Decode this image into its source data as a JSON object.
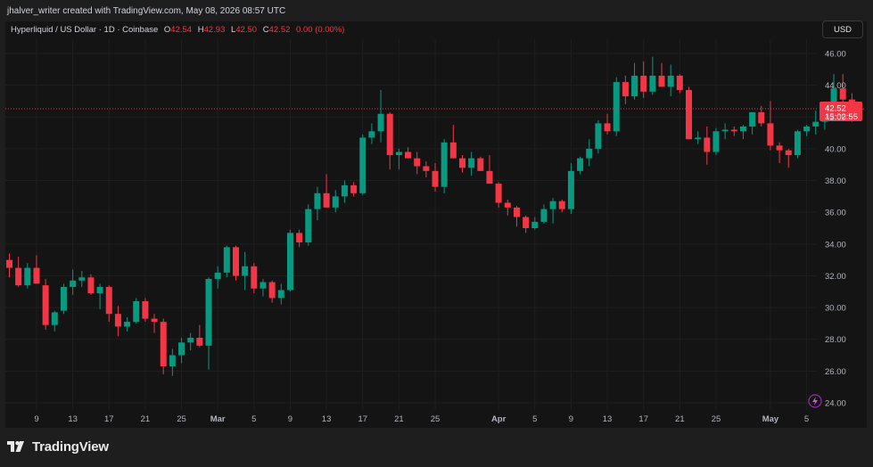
{
  "header": {
    "credit": "jhalver_writer created with TradingView.com, May 08, 2026 08:57 UTC",
    "currency": "USD"
  },
  "legend": {
    "title": "Hyperliquid / US Dollar · 1D · Coinbase",
    "o_label": "O",
    "o": "42.54",
    "h_label": "H",
    "h": "42.93",
    "l_label": "L",
    "l": "42.50",
    "c_label": "C",
    "c": "42.52",
    "change": "0.00 (0.00%)"
  },
  "price_tag": {
    "price": "42.52",
    "countdown": "15:02:55"
  },
  "brand": {
    "name": "TradingView"
  },
  "colors": {
    "up": "#089981",
    "down": "#f23645",
    "background": "#141414",
    "grid": "#1f1f1f",
    "axis_text": "#b2b5be"
  },
  "chart_data": {
    "type": "candlestick",
    "title": "Hyperliquid / US Dollar · 1D · Coinbase",
    "ylim": [
      24,
      46.5
    ],
    "y_ticks": [
      "24.00",
      "26.00",
      "28.00",
      "30.00",
      "32.00",
      "34.00",
      "36.00",
      "38.00",
      "40.00",
      "42.00",
      "44.00",
      "46.00"
    ],
    "y_tick_values": [
      24,
      26,
      28,
      30,
      32,
      34,
      36,
      38,
      40,
      42,
      44,
      46
    ],
    "x_ticks": [
      {
        "day": 3,
        "label": "9"
      },
      {
        "day": 7,
        "label": "13"
      },
      {
        "day": 11,
        "label": "17"
      },
      {
        "day": 15,
        "label": "21"
      },
      {
        "day": 19,
        "label": "25"
      },
      {
        "day": 23,
        "label": "Mar"
      },
      {
        "day": 27,
        "label": "5"
      },
      {
        "day": 31,
        "label": "9"
      },
      {
        "day": 35,
        "label": "13"
      },
      {
        "day": 39,
        "label": "17"
      },
      {
        "day": 43,
        "label": "21"
      },
      {
        "day": 47,
        "label": "25"
      },
      {
        "day": 54,
        "label": "Apr"
      },
      {
        "day": 58,
        "label": "5"
      },
      {
        "day": 62,
        "label": "9"
      },
      {
        "day": 66,
        "label": "13"
      },
      {
        "day": 70,
        "label": "17"
      },
      {
        "day": 74,
        "label": "21"
      },
      {
        "day": 78,
        "label": "25"
      },
      {
        "day": 84,
        "label": "May"
      },
      {
        "day": 88,
        "label": "5"
      }
    ],
    "first_date": "Feb 6",
    "last_date": "May 8",
    "candles": [
      {
        "o": 33.0,
        "h": 33.4,
        "l": 31.9,
        "c": 32.5
      },
      {
        "o": 32.5,
        "h": 33.2,
        "l": 31.3,
        "c": 31.4
      },
      {
        "o": 31.4,
        "h": 32.8,
        "l": 31.2,
        "c": 32.5
      },
      {
        "o": 32.5,
        "h": 33.3,
        "l": 31.6,
        "c": 31.5
      },
      {
        "o": 31.4,
        "h": 31.8,
        "l": 28.6,
        "c": 28.9
      },
      {
        "o": 28.9,
        "h": 29.8,
        "l": 28.5,
        "c": 29.7
      },
      {
        "o": 29.8,
        "h": 31.5,
        "l": 29.6,
        "c": 31.3
      },
      {
        "o": 31.3,
        "h": 32.4,
        "l": 30.8,
        "c": 31.7
      },
      {
        "o": 31.7,
        "h": 32.3,
        "l": 31.3,
        "c": 31.9
      },
      {
        "o": 31.9,
        "h": 32.1,
        "l": 30.8,
        "c": 30.9
      },
      {
        "o": 30.9,
        "h": 31.5,
        "l": 29.9,
        "c": 31.3
      },
      {
        "o": 31.3,
        "h": 31.4,
        "l": 29.1,
        "c": 29.6
      },
      {
        "o": 29.6,
        "h": 30.1,
        "l": 28.2,
        "c": 28.8
      },
      {
        "o": 28.8,
        "h": 29.4,
        "l": 28.5,
        "c": 29.1
      },
      {
        "o": 29.1,
        "h": 30.6,
        "l": 29.0,
        "c": 30.4
      },
      {
        "o": 30.4,
        "h": 30.6,
        "l": 29.1,
        "c": 29.3
      },
      {
        "o": 29.3,
        "h": 29.6,
        "l": 28.4,
        "c": 29.1
      },
      {
        "o": 29.1,
        "h": 29.3,
        "l": 25.8,
        "c": 26.3
      },
      {
        "o": 26.3,
        "h": 27.4,
        "l": 25.7,
        "c": 27.0
      },
      {
        "o": 27.0,
        "h": 28.1,
        "l": 26.5,
        "c": 27.8
      },
      {
        "o": 27.8,
        "h": 28.4,
        "l": 27.3,
        "c": 28.1
      },
      {
        "o": 28.1,
        "h": 28.9,
        "l": 27.5,
        "c": 27.6
      },
      {
        "o": 27.6,
        "h": 31.9,
        "l": 26.1,
        "c": 31.8
      },
      {
        "o": 31.8,
        "h": 32.6,
        "l": 31.2,
        "c": 32.2
      },
      {
        "o": 32.2,
        "h": 33.9,
        "l": 31.9,
        "c": 33.8
      },
      {
        "o": 33.8,
        "h": 33.9,
        "l": 31.7,
        "c": 32.0
      },
      {
        "o": 32.0,
        "h": 33.5,
        "l": 31.1,
        "c": 32.6
      },
      {
        "o": 32.6,
        "h": 32.8,
        "l": 30.9,
        "c": 31.2
      },
      {
        "o": 31.2,
        "h": 31.8,
        "l": 30.7,
        "c": 31.6
      },
      {
        "o": 31.6,
        "h": 31.7,
        "l": 30.3,
        "c": 30.6
      },
      {
        "o": 30.6,
        "h": 31.5,
        "l": 30.2,
        "c": 31.1
      },
      {
        "o": 31.1,
        "h": 34.9,
        "l": 31.0,
        "c": 34.7
      },
      {
        "o": 34.7,
        "h": 34.9,
        "l": 33.8,
        "c": 34.1
      },
      {
        "o": 34.1,
        "h": 36.5,
        "l": 33.9,
        "c": 36.2
      },
      {
        "o": 36.2,
        "h": 37.6,
        "l": 35.5,
        "c": 37.2
      },
      {
        "o": 37.2,
        "h": 38.4,
        "l": 36.3,
        "c": 36.3
      },
      {
        "o": 36.3,
        "h": 37.4,
        "l": 36.0,
        "c": 37.0
      },
      {
        "o": 37.0,
        "h": 38.0,
        "l": 36.6,
        "c": 37.7
      },
      {
        "o": 37.7,
        "h": 37.9,
        "l": 37.0,
        "c": 37.2
      },
      {
        "o": 37.2,
        "h": 40.9,
        "l": 37.1,
        "c": 40.7
      },
      {
        "o": 40.7,
        "h": 41.6,
        "l": 40.3,
        "c": 41.1
      },
      {
        "o": 41.1,
        "h": 43.7,
        "l": 40.4,
        "c": 42.2
      },
      {
        "o": 42.2,
        "h": 42.3,
        "l": 38.7,
        "c": 39.6
      },
      {
        "o": 39.6,
        "h": 40.0,
        "l": 38.7,
        "c": 39.8
      },
      {
        "o": 39.8,
        "h": 40.1,
        "l": 39.4,
        "c": 39.4
      },
      {
        "o": 39.4,
        "h": 39.8,
        "l": 38.4,
        "c": 38.9
      },
      {
        "o": 38.9,
        "h": 39.2,
        "l": 38.2,
        "c": 38.6
      },
      {
        "o": 38.6,
        "h": 39.1,
        "l": 37.3,
        "c": 37.6
      },
      {
        "o": 37.6,
        "h": 40.6,
        "l": 37.2,
        "c": 40.4
      },
      {
        "o": 40.4,
        "h": 41.5,
        "l": 39.4,
        "c": 39.4
      },
      {
        "o": 39.4,
        "h": 39.6,
        "l": 38.5,
        "c": 38.8
      },
      {
        "o": 38.8,
        "h": 39.8,
        "l": 38.3,
        "c": 39.4
      },
      {
        "o": 39.4,
        "h": 39.5,
        "l": 38.6,
        "c": 38.6
      },
      {
        "o": 38.6,
        "h": 39.6,
        "l": 38.1,
        "c": 37.8
      },
      {
        "o": 37.8,
        "h": 37.9,
        "l": 36.3,
        "c": 36.6
      },
      {
        "o": 36.6,
        "h": 36.8,
        "l": 35.8,
        "c": 36.3
      },
      {
        "o": 36.3,
        "h": 36.4,
        "l": 35.1,
        "c": 35.7
      },
      {
        "o": 35.7,
        "h": 35.8,
        "l": 34.7,
        "c": 35.0
      },
      {
        "o": 35.0,
        "h": 35.7,
        "l": 34.9,
        "c": 35.4
      },
      {
        "o": 35.4,
        "h": 36.5,
        "l": 35.3,
        "c": 36.2
      },
      {
        "o": 36.2,
        "h": 36.9,
        "l": 35.3,
        "c": 36.7
      },
      {
        "o": 36.7,
        "h": 36.8,
        "l": 36.0,
        "c": 36.2
      },
      {
        "o": 36.2,
        "h": 39.1,
        "l": 35.9,
        "c": 38.6
      },
      {
        "o": 38.6,
        "h": 39.5,
        "l": 38.4,
        "c": 39.4
      },
      {
        "o": 39.4,
        "h": 40.6,
        "l": 38.9,
        "c": 40.0
      },
      {
        "o": 40.0,
        "h": 41.8,
        "l": 39.7,
        "c": 41.6
      },
      {
        "o": 41.6,
        "h": 42.2,
        "l": 40.9,
        "c": 41.1
      },
      {
        "o": 41.1,
        "h": 44.5,
        "l": 40.8,
        "c": 44.2
      },
      {
        "o": 44.2,
        "h": 44.6,
        "l": 42.8,
        "c": 43.3
      },
      {
        "o": 43.3,
        "h": 45.4,
        "l": 43.1,
        "c": 44.6
      },
      {
        "o": 44.6,
        "h": 45.5,
        "l": 43.2,
        "c": 43.6
      },
      {
        "o": 43.6,
        "h": 45.8,
        "l": 43.4,
        "c": 44.6
      },
      {
        "o": 44.6,
        "h": 45.4,
        "l": 43.9,
        "c": 43.9
      },
      {
        "o": 43.9,
        "h": 45.3,
        "l": 43.3,
        "c": 44.6
      },
      {
        "o": 44.6,
        "h": 44.7,
        "l": 43.5,
        "c": 43.7
      },
      {
        "o": 43.7,
        "h": 43.9,
        "l": 40.6,
        "c": 40.6
      },
      {
        "o": 40.6,
        "h": 41.1,
        "l": 40.3,
        "c": 40.7
      },
      {
        "o": 40.7,
        "h": 41.4,
        "l": 39.0,
        "c": 39.8
      },
      {
        "o": 39.8,
        "h": 41.3,
        "l": 39.6,
        "c": 41.1
      },
      {
        "o": 41.1,
        "h": 41.6,
        "l": 40.6,
        "c": 41.2
      },
      {
        "o": 41.2,
        "h": 41.4,
        "l": 40.8,
        "c": 41.1
      },
      {
        "o": 41.1,
        "h": 41.5,
        "l": 40.6,
        "c": 41.4
      },
      {
        "o": 41.4,
        "h": 42.1,
        "l": 40.9,
        "c": 42.3
      },
      {
        "o": 42.3,
        "h": 42.7,
        "l": 41.4,
        "c": 41.6
      },
      {
        "o": 41.6,
        "h": 43.0,
        "l": 39.9,
        "c": 40.2
      },
      {
        "o": 40.2,
        "h": 40.4,
        "l": 39.1,
        "c": 39.9
      },
      {
        "o": 39.9,
        "h": 40.0,
        "l": 38.8,
        "c": 39.6
      },
      {
        "o": 39.6,
        "h": 41.2,
        "l": 39.4,
        "c": 41.1
      },
      {
        "o": 41.1,
        "h": 41.5,
        "l": 40.8,
        "c": 41.4
      },
      {
        "o": 41.4,
        "h": 42.4,
        "l": 40.9,
        "c": 41.7
      },
      {
        "o": 41.7,
        "h": 42.6,
        "l": 41.2,
        "c": 42.0
      },
      {
        "o": 42.0,
        "h": 44.7,
        "l": 42.1,
        "c": 43.8
      },
      {
        "o": 43.8,
        "h": 44.7,
        "l": 42.9,
        "c": 43.1
      },
      {
        "o": 43.1,
        "h": 43.5,
        "l": 41.7,
        "c": 42.5
      },
      {
        "o": 42.54,
        "h": 42.93,
        "l": 42.5,
        "c": 42.52
      }
    ]
  }
}
